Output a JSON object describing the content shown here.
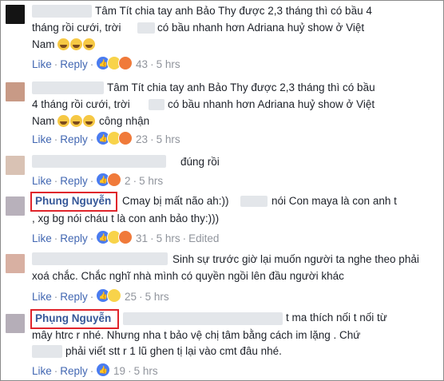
{
  "actions": {
    "like": "Like",
    "reply": "Reply",
    "edited": "Edited"
  },
  "comments": [
    {
      "lines": [
        "Tâm Tít chia tay anh Bảo Thy được 2,3 tháng thì có bầu 4",
        "tháng rồi cưới, trời",
        "có bầu nhanh hơn Adriana huỷ show ở Việt",
        "Nam"
      ],
      "reactions": [
        "like-icon",
        "haha-icon",
        "angry-icon"
      ],
      "count": "43",
      "time": "5 hrs"
    },
    {
      "lines": [
        "Tâm Tít chia tay anh Bảo Thy được 2,3 tháng thì có bầu",
        "4 tháng rồi cưới, trời",
        "có bầu nhanh hơn Adriana huỷ show ở Việt",
        "Nam",
        "công nhận"
      ],
      "reactions": [
        "like-icon",
        "haha-icon",
        "angry-icon"
      ],
      "count": "23",
      "time": "5 hrs"
    },
    {
      "lines": [
        "đúng rồi"
      ],
      "reactions": [
        "like-icon",
        "angry-icon"
      ],
      "count": "2",
      "time": "5 hrs"
    },
    {
      "name": "Phung Nguyễn",
      "lines": [
        "Cmay bị mất não ah:))",
        "nói Con maya là con anh t",
        ", xg bg nói cháu t là con anh bảo thy:)))"
      ],
      "reactions": [
        "like-icon",
        "haha-icon",
        "angry-icon"
      ],
      "count": "31",
      "time": "5 hrs"
    },
    {
      "lines": [
        "Sinh sự trước giờ lại muốn người ta nghe theo phải",
        "xoá chắc. Chắc nghĩ nhà mình có quyền ngồi lên đầu người khác"
      ],
      "reactions": [
        "like-icon",
        "sad-icon"
      ],
      "count": "25",
      "time": "5 hrs"
    },
    {
      "name": "Phụng Nguyễn",
      "lines": [
        "t ma thích nối t nối từ",
        "mây htrc r nhé. Nhưng nha t bảo vệ chị tâm bằng cách im lặng . Chứ",
        "phải viết stt r 1 lũ ghen tị lại vào cmt đâu nhé."
      ],
      "reactions": [
        "like-icon"
      ],
      "count": "19",
      "time": "5 hrs"
    }
  ],
  "colors": {
    "link": "#4267b2",
    "name": "#365899",
    "meta": "#90949c",
    "highlight": "#e0242b"
  }
}
